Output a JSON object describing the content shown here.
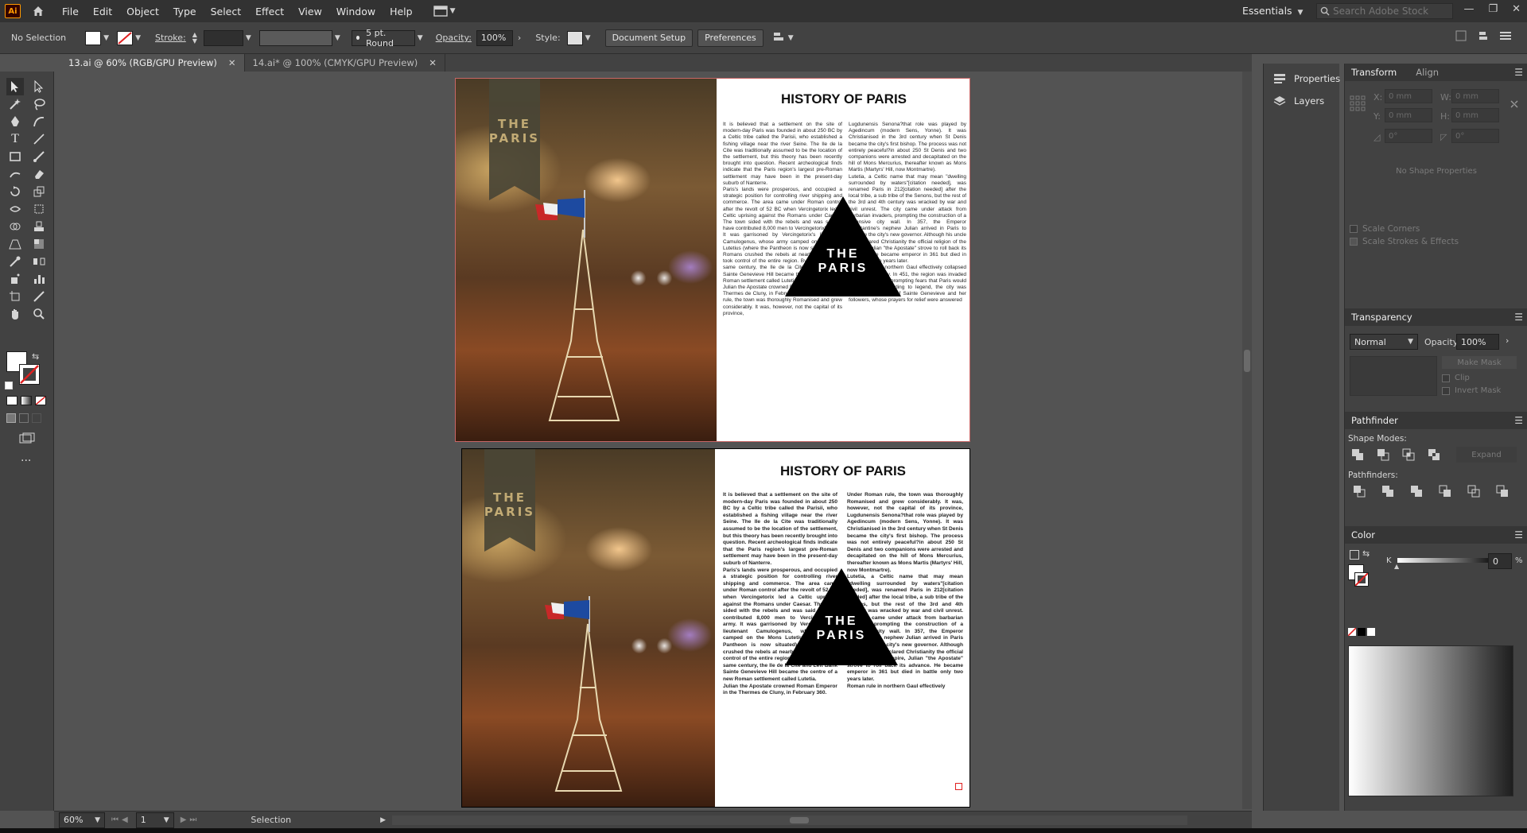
{
  "app": {
    "logo": "Ai",
    "menu": [
      "File",
      "Edit",
      "Object",
      "Type",
      "Select",
      "Effect",
      "View",
      "Window",
      "Help"
    ],
    "workspace": "Essentials",
    "search_placeholder": "Search Adobe Stock"
  },
  "control_bar": {
    "selection": "No Selection",
    "stroke_label": "Stroke:",
    "brush": "5 pt. Round",
    "opacity_label": "Opacity:",
    "opacity_value": "100%",
    "style_label": "Style:",
    "document_setup": "Document Setup",
    "preferences": "Preferences"
  },
  "tabs": [
    {
      "label": "13.ai @ 60% (RGB/GPU Preview)",
      "active": true
    },
    {
      "label": "14.ai* @ 100% (CMYK/GPU Preview)",
      "active": false
    }
  ],
  "artboards": [
    {
      "title": "HISTORY OF PARIS",
      "ribbon": [
        "THE",
        "PARIS"
      ],
      "triangle": [
        "THE",
        "PARIS"
      ],
      "col1": "It is believed that a settlement on the site of modern-day Paris was founded in about 250 BC by a Celtic tribe called the Parisii, who established a fishing village near the river Seine. The Ile de la Cite was traditionally assumed to be the location of the settlement, but this theory has been recently brought into question. Recent archeological finds indicate that the Paris region's largest pre-Roman settlement may have been in the present-day suburb of Nanterre.\nParis's lands were prosperous, and occupied a strategic position for controlling river shipping and commerce. The area came under Roman control after the revolt of 52 BC when Vercingetorix led a Celtic uprising against the Romans under Caesar. The town sided with the rebels and was said to have contributed 8,000 men to Vercingetorix's army. It was garrisoned by Vercingetorix's lieutenant Camulogenus, whose army camped on the Mons Lutetius (where the Pantheon is now situated). The Romans crushed the rebels at nearby Melun and took control of the entire region. By the end of the same century, the Ile de la Cite and Left Bank Sainte Genevieve Hill became the centre of a new Roman settlement called Lutetia.\nJulian the Apostate crowned Roman Emperor in the Thermes de Cluny, in February 360. Under Roman rule, the town was thoroughly Romanised and grew considerably. It was, however, not the capital of its province,",
      "col2": "Lugdunensis Senona?that role was played by Agedincum (modern Sens, Yonne). It was Christianised in the 3rd century when St Denis became the city's first bishop. The process was not entirely peaceful?in about 250 St Denis and two companions were arrested and decapitated on the hill of Mons Mercurius, thereafter known as Mons Martis (Martyrs' Hill, now Montmartre).\nLutetia, a Celtic name that may mean \"dwelling surrounded by waters\"[citation needed], was renamed Paris in 212[citation needed] after the local tribe, a sub tribe of the Senons, but the rest of the 3rd and 4th century was wracked by war and civil unrest. The city came under attack from barbarian invaders, prompting the construction of a defensive city wall. In 357, the Emperor Constantine's nephew Julian arrived in Paris to become the city's new governor. Although his uncle had declared Christianity the official religion of the Empire, Julian \"the Apostate\" strove to roll back its advance. He became emperor in 361 but died in battle only two years later.\nRoman rule in northern Gaul effectively collapsed in the 5th century. In 451, the region was invaded by Attila the Hun, prompting fears that Paris would be attacked. According to legend, the city was saved by the piety of Sainte Genevieve and her followers, whose prayers for relief were answered"
    },
    {
      "title": "HISTORY OF PARIS",
      "ribbon": [
        "THE",
        "PARIS"
      ],
      "triangle": [
        "THE",
        "PARIS"
      ],
      "col1": "It is believed that a settlement on the site of modern-day Paris was founded in about 250 BC by a Celtic tribe called the Parisii, who established a fishing village near the river Seine. The Ile de la Cite was traditionally assumed to be the location of the settlement, but this theory has been recently brought into question. Recent archeological finds indicate that the Paris region's largest pre-Roman settlement may have been in the present-day suburb of Nanterre.\nParis's lands were prosperous, and occupied a strategic position for controlling river shipping and commerce. The area came under Roman control after the revolt of 52 BC when Vercingetorix led a Celtic uprising against the Romans under Caesar. The town sided with the rebels and was said to have contributed 8,000 men to Vercingetorix's army. It was garrisoned by Vercingetorix's lieutenant Camulogenus, whose army camped on the Mons Lutetius (where the Pantheon is now situated). The Romans crushed the rebels at nearby Melun and took control of the entire region. By the end of the same century, the Ile de la Cite and Left Bank Sainte Genevieve Hill became the centre of a new Roman settlement called Lutetia.\nJulian the Apostate crowned Roman Emperor in the Thermes de Cluny, in February 360.",
      "col2": "Under Roman rule, the town was thoroughly Romanised and grew considerably. It was, however, not the capital of its province, Lugdunensis Senona?that role was played by Agedincum (modern Sens, Yonne). It was Christianised in the 3rd century when St Denis became the city's first bishop. The process was not entirely peaceful?in about 250 St Denis and two companions were arrested and decapitated on the hill of Mons Mercurius, thereafter known as Mons Martis (Martyrs' Hill, now Montmartre).\nLutetia, a Celtic name that may mean \"dwelling surrounded by waters\"[citation needed], was renamed Paris in 212[citation needed] after the local tribe, a sub tribe of the Senons, but the rest of the 3rd and 4th century was wracked by war and civil unrest. The city came under attack from barbarian invaders, prompting the construction of a defensive city wall. In 357, the Emperor Constantine's nephew Julian arrived in Paris to become the city's new governor. Although his uncle had declared Christianity the official religion of the Empire, Julian \"the Apostate\" strove to roll back its advance. He became emperor in 361 but died in battle only two years later.\nRoman rule in northern Gaul effectively"
    }
  ],
  "panels": {
    "properties": "Properties",
    "layers": "Layers",
    "transform_tab": "Transform",
    "align_tab": "Align",
    "transform_fields": {
      "x": "X:",
      "y": "Y:",
      "w": "W:",
      "h": "H:",
      "zero": "0 mm",
      "angle": "0°"
    },
    "no_shape": "No Shape Properties",
    "scale_corners": "Scale Corners",
    "scale_strokes": "Scale Strokes & Effects",
    "transparency": "Transparency",
    "blend_mode": "Normal",
    "opacity_label": "Opacity:",
    "opacity_value": "100%",
    "make_mask": "Make Mask",
    "clip": "Clip",
    "invert_mask": "Invert Mask",
    "pathfinder": "Pathfinder",
    "shape_modes": "Shape Modes:",
    "expand": "Expand",
    "pathfinders": "Pathfinders:",
    "color": "Color",
    "k_label": "K",
    "k_value": "0",
    "percent": "%"
  },
  "status": {
    "zoom": "60%",
    "artboard": "1",
    "tool": "Selection"
  },
  "colors": {
    "ui_dark": "#323232",
    "ui_mid": "#424242",
    "canvas": "#535353",
    "brand": "#ff9a00"
  }
}
